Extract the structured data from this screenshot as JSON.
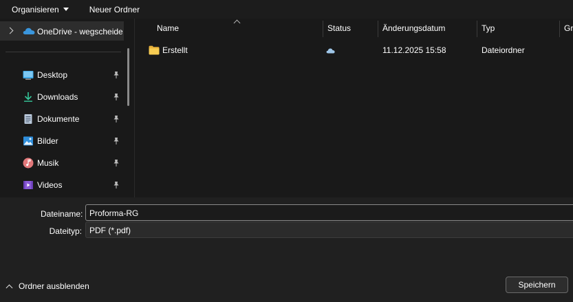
{
  "toolbar": {
    "organize_label": "Organisieren",
    "new_folder_label": "Neuer Ordner"
  },
  "nav": {
    "onedrive_label": "OneDrive - wegscheide",
    "quick_access": [
      {
        "label": "Desktop",
        "icon": "desktop-icon"
      },
      {
        "label": "Downloads",
        "icon": "downloads-icon"
      },
      {
        "label": "Dokumente",
        "icon": "documents-icon"
      },
      {
        "label": "Bilder",
        "icon": "pictures-icon"
      },
      {
        "label": "Musik",
        "icon": "music-icon"
      },
      {
        "label": "Videos",
        "icon": "videos-icon"
      }
    ]
  },
  "columns": {
    "name": "Name",
    "status": "Status",
    "date": "Änderungsdatum",
    "type": "Typ",
    "size": "Gr"
  },
  "files": [
    {
      "name": "Erstellt",
      "status_icon": "cloud-status-icon",
      "date": "11.12.2025 15:58",
      "type": "Dateiordner"
    }
  ],
  "form": {
    "filename_label": "Dateiname:",
    "filename_value": "Proforma-RG",
    "filetype_label": "Dateityp:",
    "filetype_value": "PDF (*.pdf)"
  },
  "footer": {
    "hide_folders_label": "Ordner ausblenden",
    "save_label": "Speichern"
  },
  "colors": {
    "background": "#191919",
    "bottom_panel": "#202020",
    "folder_yellow": "#f4c542",
    "onedrive_blue": "#3a96dd"
  }
}
